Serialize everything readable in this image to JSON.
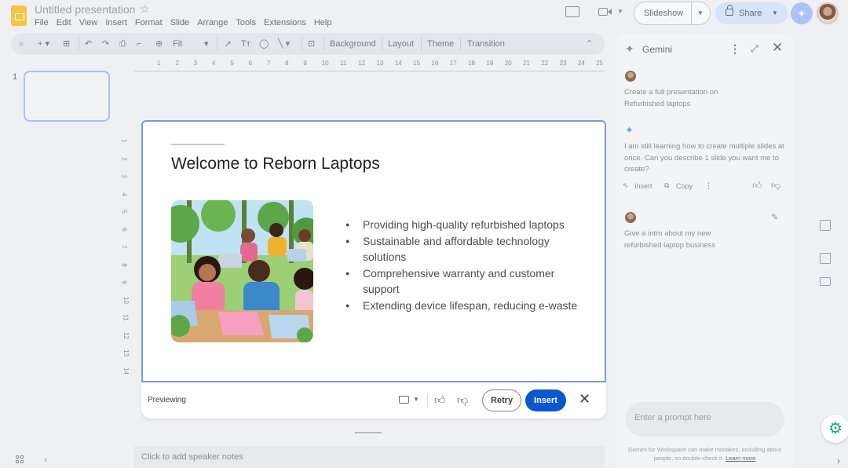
{
  "app": {
    "doc_title": "Untitled presentation",
    "menus": [
      "File",
      "Edit",
      "View",
      "Insert",
      "Format",
      "Slide",
      "Arrange",
      "Tools",
      "Extensions",
      "Help"
    ]
  },
  "header": {
    "slideshow_label": "Slideshow",
    "share_label": "Share"
  },
  "toolbar": {
    "zoom_label": "Fit",
    "background_label": "Background",
    "layout_label": "Layout",
    "theme_label": "Theme",
    "transition_label": "Transition"
  },
  "ruler": {
    "h_numbers": [
      "1",
      "2",
      "3",
      "4",
      "5",
      "6",
      "7",
      "8",
      "9",
      "10",
      "11",
      "12",
      "13",
      "14",
      "15",
      "16",
      "17",
      "18",
      "19",
      "20",
      "21",
      "22",
      "23",
      "24",
      "25"
    ],
    "v_numbers": [
      "1",
      "2",
      "3",
      "4",
      "5",
      "6",
      "7",
      "8",
      "9",
      "10",
      "11",
      "12",
      "13",
      "14"
    ]
  },
  "filmstrip": {
    "slide_number": "1"
  },
  "slide": {
    "title": "Welcome to Reborn Laptops",
    "bullets": [
      "Providing high-quality refurbished laptops",
      "Sustainable and affordable technology solutions",
      "Comprehensive warranty and customer support",
      "Extending device lifespan, reducing e-waste"
    ]
  },
  "preview_bar": {
    "status": "Previewing",
    "retry_label": "Retry",
    "insert_label": "Insert"
  },
  "notes": {
    "placeholder": "Click to add speaker notes"
  },
  "gemini": {
    "title": "Gemini",
    "messages": [
      {
        "role": "user",
        "text": "Create a full presentation on Refurbished laptops"
      },
      {
        "role": "assistant",
        "text": "I am still learning how to create multiple slides at once. Can you describe 1 slide you want me to create?"
      },
      {
        "role": "user",
        "text": "Give a intro about my new refurbished laptop business"
      }
    ],
    "insert_action": "Insert",
    "copy_action": "Copy",
    "input_placeholder": "Enter a prompt here",
    "disclaimer": "Gemini for Workspace can make mistakes, including about people, so double-check it.",
    "learn_more": "Learn more"
  },
  "colors": {
    "accent": "#0b57d0",
    "slide_border": "#7c9bd3",
    "share_bg": "#d7e4f8"
  }
}
